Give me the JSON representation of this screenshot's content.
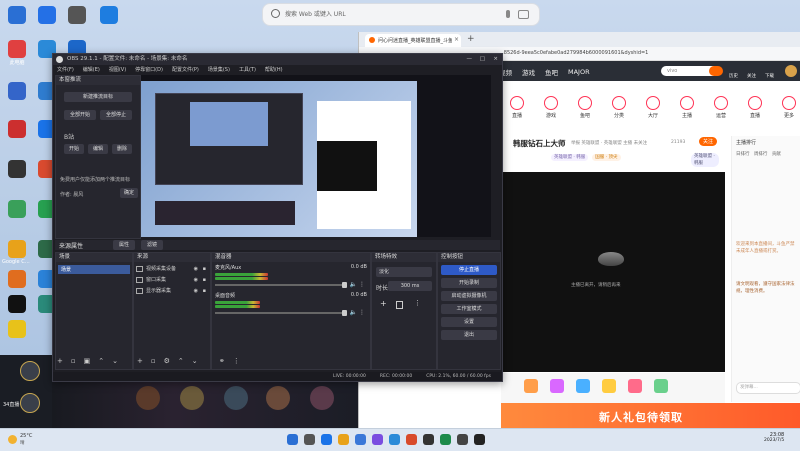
{
  "desktop_icons": [
    {
      "label": "",
      "color": "#2a6fd4"
    },
    {
      "label": "",
      "color": "#2470e6"
    },
    {
      "label": "",
      "color": "#555"
    },
    {
      "label": "",
      "color": "#1e7de0"
    },
    {
      "label": "此电脑",
      "color": "#e04040"
    },
    {
      "label": "",
      "color": "#2b8ad8"
    },
    {
      "label": "",
      "color": "#1c67c9"
    },
    {
      "label": "",
      "color": "#3465c9"
    },
    {
      "label": "",
      "color": "#2f7ccf"
    },
    {
      "label": "",
      "color": "#cc2f2f"
    },
    {
      "label": "",
      "color": "#1a73e8"
    },
    {
      "label": "",
      "color": "#333"
    },
    {
      "label": "",
      "color": "#d94a2f"
    },
    {
      "label": "",
      "color": "#3aa05a"
    },
    {
      "label": "Google Chrome",
      "color": "#e8a21a"
    },
    {
      "label": "",
      "color": "#2d6a48"
    },
    {
      "label": "",
      "color": "#e06d1f"
    },
    {
      "label": "",
      "color": "#27a050"
    },
    {
      "label": "",
      "color": "#111"
    },
    {
      "label": "",
      "color": "#2b82d8"
    },
    {
      "label": "",
      "color": "#e8c21a"
    },
    {
      "label": "",
      "color": "#2a8a7a"
    }
  ],
  "top_search": {
    "placeholder": "搜索 Web 或键入 URL"
  },
  "obs": {
    "title": "OBS 29.1.1 - 配置文件: 未命名 - 场景集: 未命名",
    "menu": [
      "文件(F)",
      "编辑(E)",
      "视图(V)",
      "停靠窗口(D)",
      "配置文件(P)",
      "场景集(S)",
      "工具(T)",
      "帮助(H)"
    ],
    "left_panel_title": "本窗推流",
    "left_buttons": [
      "新建推流目标",
      "全部开始",
      "全部停止"
    ],
    "section_label": "B站",
    "small_buttons": [
      "开始",
      "编辑",
      "删除"
    ],
    "info_text": "免费用户仅能添加两个推流目标",
    "author_label": "作者: 晨风",
    "ok": "确定",
    "tab_labels": [
      "来源属性",
      "滤镜"
    ],
    "tab_btn_left": "属性",
    "tab_btn_right": "滤镜",
    "scenes_title": "场景",
    "scene_item": "场景",
    "sources_title": "来源",
    "sources": [
      "视频采集设备",
      "窗口采集",
      "显示器采集"
    ],
    "mixer_title": "混音器",
    "mixer": [
      {
        "name": "麦克风/Aux",
        "db": "0.0 dB",
        "level": 0.35
      },
      {
        "name": "桌面音频",
        "db": "0.0 dB",
        "level": 0.3
      }
    ],
    "transitions_title": "转场特效",
    "transition_type": "淡化",
    "duration_label": "时长",
    "duration_value": "300 ms",
    "controls_title": "控制按钮",
    "controls": [
      "停止直播",
      "开始录制",
      "启动虚拟摄像机",
      "工作室模式",
      "设置",
      "退出"
    ],
    "status": {
      "live": "LIVE: 00:00:00",
      "rec": "REC: 00:00:00",
      "cpu": "CPU: 2.1%, 60.00 / 60.00 fps"
    }
  },
  "browser": {
    "tab_title": "问心问迷直播_英雄联盟直播_斗鱼",
    "url": "...8526d-9eea5c0efabe0ad279984b6000091601&dyshid=1",
    "nav": [
      "视频",
      "游戏",
      "鱼吧",
      "MAJOR"
    ],
    "search_value": "vivo",
    "right_nav": [
      "历史",
      "关注",
      "下载"
    ],
    "categories": [
      "直播",
      "游戏",
      "鱼吧",
      "分类",
      "大厅",
      "主播",
      "运营",
      "直播",
      "更多"
    ],
    "room_title": "韩服钻石上大师",
    "room_meta": "举报  英雄联盟 · 英雄联盟  主播  未关注",
    "follow": "21193",
    "fans": "关注",
    "chips": [
      "英雄联盟 · 韩服",
      "国服 · 顶尖"
    ],
    "player_text": "主播已离开，请稍后再来",
    "gift_labels": [
      "",
      "",
      "",
      "",
      "",
      ""
    ],
    "banner_text": "新人礼包待领取",
    "chat_header": "主播排行",
    "chat_tabs": [
      "日排行",
      "周排行",
      "贡献"
    ],
    "chat_msgs": [
      "欢迎来到本直播间，斗鱼严禁未成年人直播或打赏。",
      "请文明观看，遵守国家法律法规，理性消费。"
    ],
    "chat_input": "发弹幕..."
  },
  "live_overlay": {
    "names": [
      "",
      "",
      ""
    ],
    "bottom_label": "34直播"
  },
  "taskbar": {
    "time": "23:08",
    "date": "2023/7/5",
    "weather": "25°C",
    "weather_desc": "晴"
  }
}
